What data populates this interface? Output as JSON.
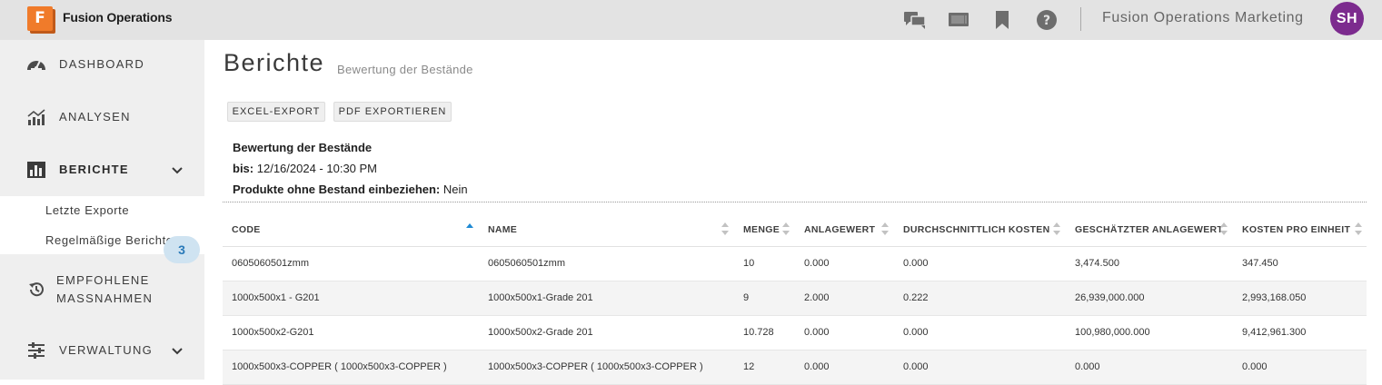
{
  "app": {
    "logo_letter": "F",
    "title": "Fusion Operations",
    "org_name": "Fusion Operations Marketing",
    "user_initials": "SH",
    "icons": [
      "chat-icon",
      "screen-icon",
      "bookmark-icon",
      "help-icon"
    ]
  },
  "sidebar": {
    "dashboard": "DASHBOARD",
    "analysen": "ANALYSEN",
    "berichte": "BERICHTE",
    "sub_items": [
      "Letzte Exporte",
      "Regelmäßige Berichte"
    ],
    "empfohlene_line1": "EMPFOHLENE",
    "empfohlene_line2": "MASSNAHMEN",
    "empfohlene_badge": "3",
    "verwaltung": "VERWALTUNG"
  },
  "page": {
    "title": "Berichte",
    "subtitle": "Bewertung der Bestände",
    "excel_button": "EXCEL-EXPORT",
    "pdf_button": "PDF EXPORTIEREN",
    "report_title": "Bewertung der Bestände",
    "until_label": "bis:",
    "until_value": "12/16/2024 - 10:30 PM",
    "include_label": "Produkte ohne Bestand einbeziehen:",
    "include_value": "Nein"
  },
  "table": {
    "headers": {
      "code": "CODE",
      "name": "NAME",
      "menge": "MENGE",
      "anlagewert": "ANLAGEWERT",
      "durchschnitt": "DURCHSCHNITTLICH KOSTEN",
      "geschaetzt": "GESCHÄTZTER ANLAGEWERT",
      "kosten": "KOSTEN PRO EINHEIT"
    },
    "rows": [
      {
        "code": "0605060501zmm",
        "name": "0605060501zmm",
        "menge": "10",
        "anlagewert": "0.000",
        "durchschnitt": "0.000",
        "geschaetzt": "3,474.500",
        "kosten": "347.450"
      },
      {
        "code": "1000x500x1 - G201",
        "name": "1000x500x1-Grade 201",
        "menge": "9",
        "anlagewert": "2.000",
        "durchschnitt": "0.222",
        "geschaetzt": "26,939,000.000",
        "kosten": "2,993,168.050"
      },
      {
        "code": "1000x500x2-G201",
        "name": "1000x500x2-Grade 201",
        "menge": "10.728",
        "anlagewert": "0.000",
        "durchschnitt": "0.000",
        "geschaetzt": "100,980,000.000",
        "kosten": "9,412,961.300"
      },
      {
        "code": "1000x500x3-COPPER ( 1000x500x3-COPPER )",
        "name": "1000x500x3-COPPER ( 1000x500x3-COPPER )",
        "menge": "12",
        "anlagewert": "0.000",
        "durchschnitt": "0.000",
        "geschaetzt": "0.000",
        "kosten": "0.000"
      }
    ]
  },
  "colors": {
    "topbar": "#e3e3e3",
    "sidebar": "#efefef",
    "logo_orange": "#f07b2a",
    "avatar": "#7c2b8e",
    "badge_bg": "#cfe3f1",
    "badge_text": "#2a7ab9",
    "sort_active": "#1f8ad4"
  }
}
